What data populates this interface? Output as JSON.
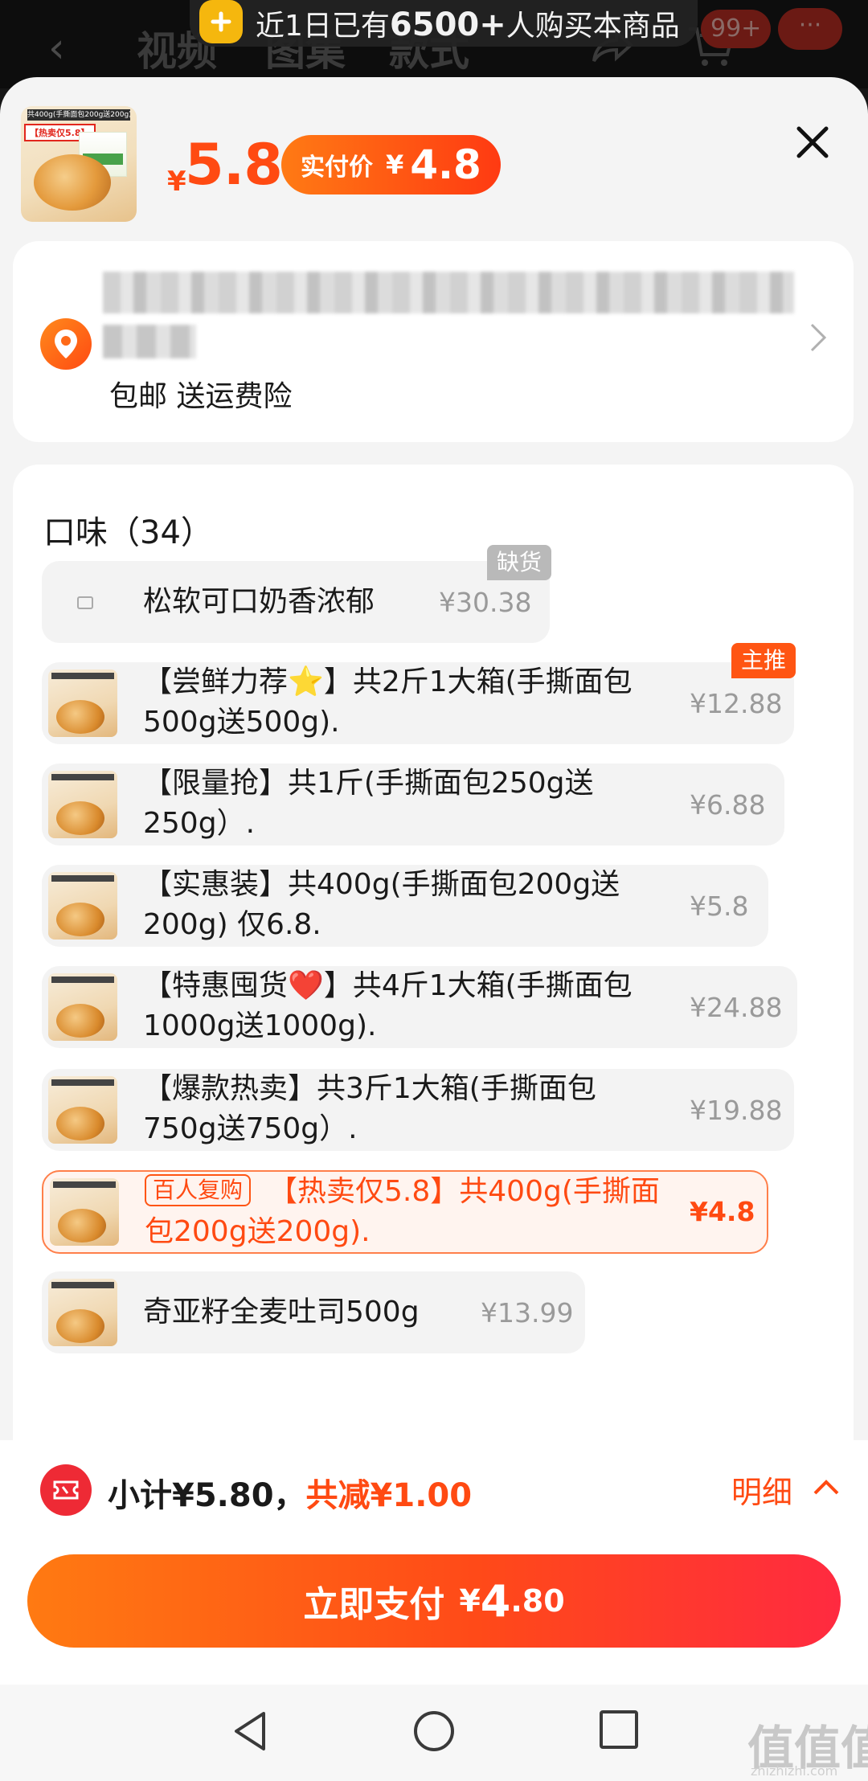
{
  "background": {
    "banner_pre": "近1日已有",
    "banner_num": "6500+",
    "banner_post": "人购买本商品",
    "tabs": [
      "视频",
      "图集",
      "款式"
    ],
    "cart_badge": "99+",
    "more": "···"
  },
  "header": {
    "thumb_top": "共400g(手撕面包200g送200g)",
    "thumb_tag": "【热卖仅5.8】",
    "currency": "¥",
    "price": "5.8",
    "pay_label": "实付价",
    "pay_currency": "¥",
    "pay_value": "4.8"
  },
  "address": {
    "shipping": "包邮 送运费险"
  },
  "options": {
    "title": "口味（34）",
    "items": [
      {
        "name": "松软可口奶香浓郁",
        "price": "¥30.38",
        "tag": "缺货"
      },
      {
        "name": "【尝鲜力荐⭐】共2斤1大箱(手撕面包500g送500g).",
        "price": "¥12.88",
        "tag": "主推"
      },
      {
        "name": "【限量抢】共1斤(手撕面包250g送250g）.",
        "price": "¥6.88"
      },
      {
        "name": "【实惠装】共400g(手撕面包200g送200g) 仅6.8.",
        "price": "¥5.8"
      },
      {
        "name": "【特惠囤货❤️】共4斤1大箱(手撕面包1000g送1000g).",
        "price": "¥24.88"
      },
      {
        "name": "【爆款热卖】共3斤1大箱(手撕面包750g送750g）.",
        "price": "¥19.88"
      },
      {
        "name": "【热卖仅5.8】共400g(手撕面包200g送200g).",
        "price": "¥4.8",
        "tag": "百人复购"
      },
      {
        "name": "奇亚籽全麦吐司500g",
        "price": "¥13.99"
      }
    ]
  },
  "footer": {
    "subtotal": "小计¥5.80，",
    "discount": "共减¥1.00",
    "detail": "明细",
    "pay_label": "立即支付",
    "pay_currency": "¥",
    "pay_int": "4",
    "pay_dec": ".80"
  },
  "watermark": {
    "main": "值值值",
    "sub": "zhizhizhi.com"
  }
}
